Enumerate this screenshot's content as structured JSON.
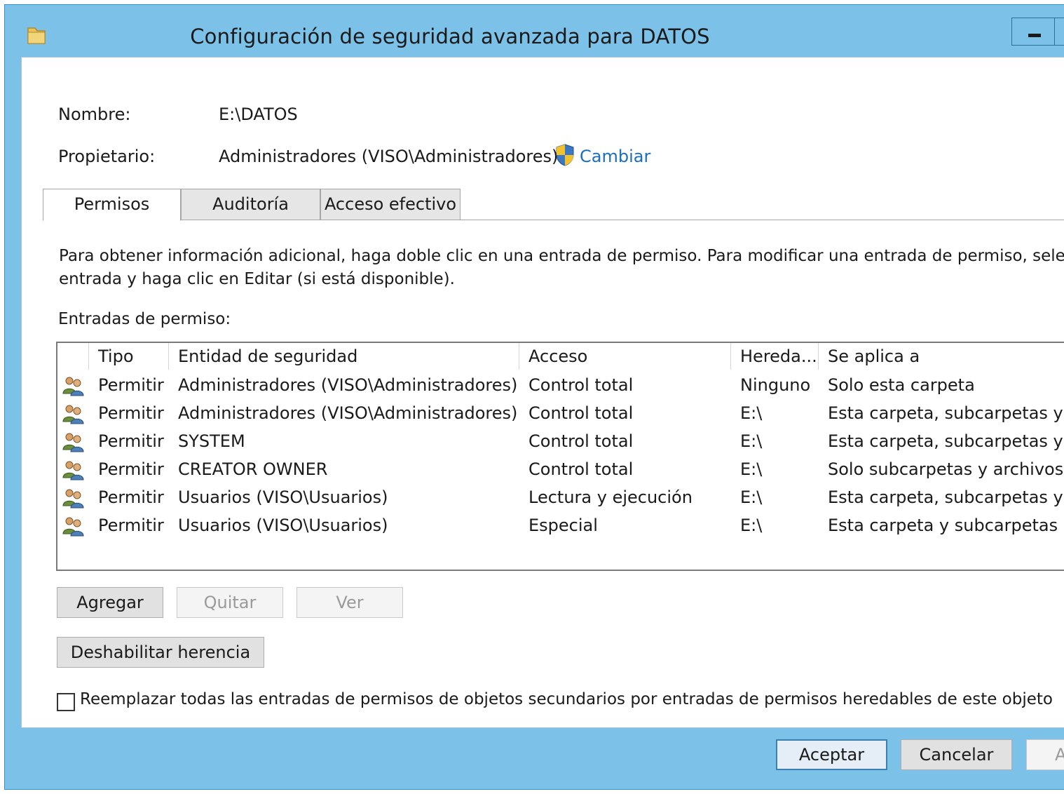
{
  "window": {
    "title": "Configuración de seguridad avanzada para DATOS"
  },
  "info": {
    "name_label": "Nombre:",
    "name_value": "E:\\DATOS",
    "owner_label": "Propietario:",
    "owner_value": "Administradores (VISO\\Administradores)",
    "change_link": "Cambiar"
  },
  "tabs": [
    {
      "label": "Permisos",
      "active": true
    },
    {
      "label": "Auditoría",
      "active": false
    },
    {
      "label": "Acceso efectivo",
      "active": false
    }
  ],
  "description": {
    "line1": "Para obtener información adicional, haga doble clic en una entrada de permiso. Para modificar una entrada de permiso, seleccior",
    "line2": "entrada y haga clic en Editar (si está disponible)."
  },
  "entries_label": "Entradas de permiso:",
  "table": {
    "headers": [
      "Tipo",
      "Entidad de seguridad",
      "Acceso",
      "Hereda...",
      "Se aplica a"
    ],
    "rows": [
      [
        "Permitir",
        "Administradores (VISO\\Administradores)",
        "Control total",
        "Ninguno",
        "Solo esta carpeta"
      ],
      [
        "Permitir",
        "Administradores (VISO\\Administradores)",
        "Control total",
        "E:\\",
        "Esta carpeta, subcarpetas y arc."
      ],
      [
        "Permitir",
        "SYSTEM",
        "Control total",
        "E:\\",
        "Esta carpeta, subcarpetas y arc."
      ],
      [
        "Permitir",
        "CREATOR OWNER",
        "Control total",
        "E:\\",
        "Solo subcarpetas y archivos"
      ],
      [
        "Permitir",
        "Usuarios (VISO\\Usuarios)",
        "Lectura y ejecución",
        "E:\\",
        "Esta carpeta, subcarpetas y arc."
      ],
      [
        "Permitir",
        "Usuarios (VISO\\Usuarios)",
        "Especial",
        "E:\\",
        "Esta carpeta y subcarpetas"
      ]
    ]
  },
  "buttons": {
    "add": "Agregar",
    "remove": "Quitar",
    "view": "Ver",
    "disable_inheritance": "Deshabilitar herencia",
    "ok": "Aceptar",
    "cancel": "Cancelar",
    "apply": "A"
  },
  "checkbox": {
    "label": "Reemplazar todas las entradas de permisos de objetos secundarios por entradas de permisos heredables de este objeto",
    "checked": false
  },
  "colors": {
    "frame": "#7cc1e8",
    "link": "#1b6fbd",
    "primary_border": "#3c7fb1"
  },
  "icons": [
    "folder-icon",
    "uac-shield-icon",
    "user-group-icon"
  ]
}
